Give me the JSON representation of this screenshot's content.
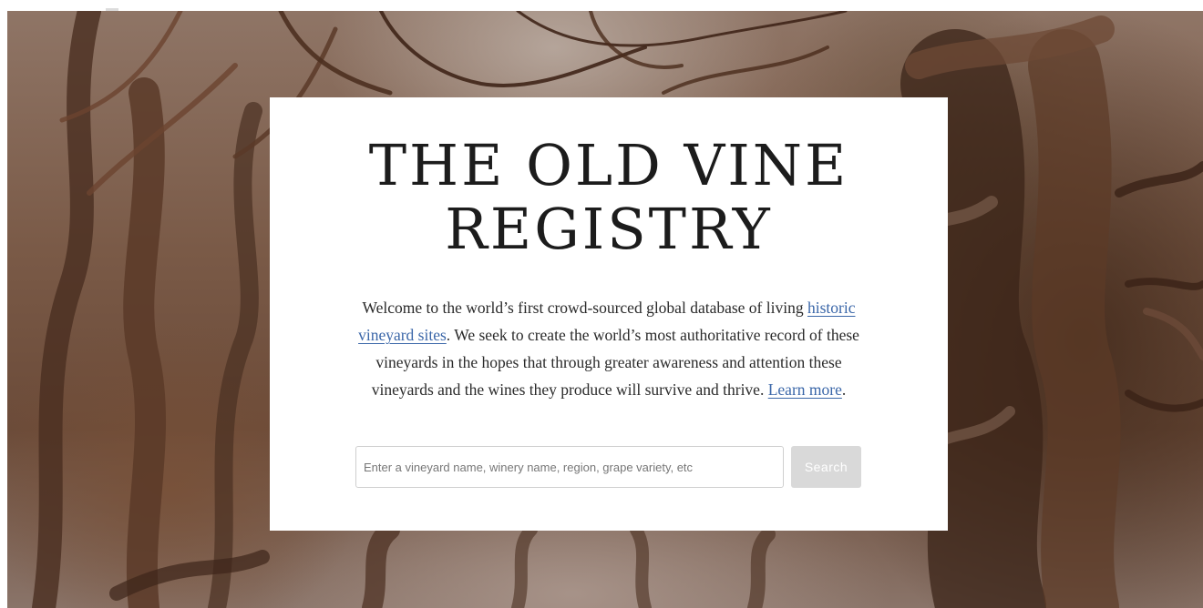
{
  "site": {
    "title_line1": "The Old Vine",
    "title_line2": "Registry"
  },
  "intro": {
    "text_before_link": "Welcome to the world’s first crowd-sourced global database of living ",
    "link_historic": "historic vineyard sites",
    "text_after_link": ". We seek to create the world’s most authoritative record of these vineyards in the hopes that through greater awareness and attention these vineyards and the wines they produce will survive and thrive. ",
    "link_learn_more": "Learn more",
    "text_end": "."
  },
  "search": {
    "placeholder": "Enter a vineyard name, winery name, region, grape variety, etc",
    "value": "",
    "button_label": "Search"
  },
  "colors": {
    "link": "#3a66a8",
    "button_bg": "#d9d9d9",
    "card_bg": "#ffffff"
  }
}
